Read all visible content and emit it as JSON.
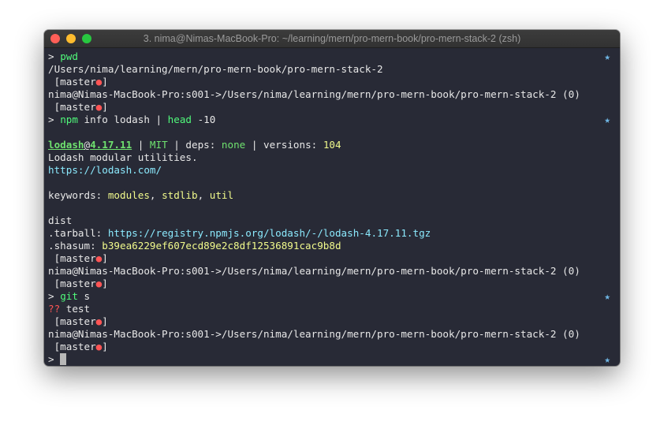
{
  "window": {
    "title": "3. nima@Nimas-MacBook-Pro: ~/learning/mern/pro-mern-book/pro-mern-stack-2 (zsh)"
  },
  "prompt_symbol": ">",
  "star": "★",
  "branch": {
    "open": "[master",
    "dot": "●",
    "close": "]"
  },
  "status_line": "nima@Nimas-MacBook-Pro:s001->/Users/nima/learning/mern/pro-mern-book/pro-mern-stack-2 (0)",
  "lines": {
    "cmd1": "pwd",
    "pwd_out": "/Users/nima/learning/mern/pro-mern-book/pro-mern-stack-2",
    "cmd2_a": "npm",
    "cmd2_b": " info lodash | ",
    "cmd2_c": "head",
    "cmd2_d": " -10",
    "pkg_name": "lodash",
    "pkg_at": "@",
    "pkg_ver": "4.17.11",
    "pkg_sep1": " | ",
    "pkg_license": "MIT",
    "pkg_sep2": " | deps: ",
    "pkg_deps": "none",
    "pkg_sep3": " | versions: ",
    "pkg_versions": "104",
    "desc": "Lodash modular utilities.",
    "homepage": "https://lodash.com/",
    "kw_label": "keywords: ",
    "kw1": "modules",
    "kw_comma1": ", ",
    "kw2": "stdlib",
    "kw_comma2": ", ",
    "kw3": "util",
    "dist": "dist",
    "tarball_label": ".tarball: ",
    "tarball": "https://registry.npmjs.org/lodash/-/lodash-4.17.11.tgz",
    "shasum_label": ".shasum: ",
    "shasum": "b39ea6229ef607ecd89e2c8df12536891cac9b8d",
    "cmd3_a": "git",
    "cmd3_b": " s",
    "untracked_mark": "??",
    "untracked_file": " test"
  }
}
